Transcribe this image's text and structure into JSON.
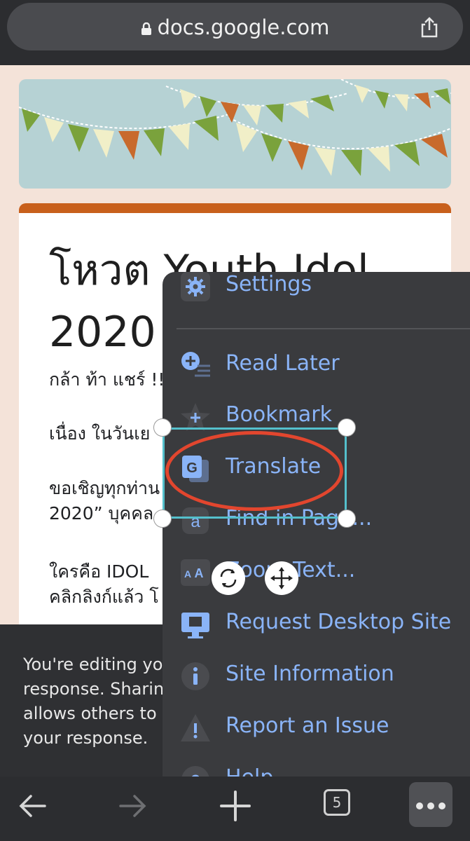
{
  "browser": {
    "url": "docs.google.com",
    "tab_count": "5"
  },
  "form": {
    "title": "โหวต Youth Idol 2020",
    "paragraphs": [
      "กล้า ท้า แชร์ !!",
      "เนื่อง ในวันเย",
      "ขอเชิญทุกท่าน",
      "2020” บุคคล",
      "ใครคือ IDOL",
      "คลิกลิงก์แล้ว โ"
    ]
  },
  "notice": {
    "text": "You're editing yo\nresponse. Sharin\nallows others to\nyour response."
  },
  "menu": {
    "items": [
      {
        "label": "Settings",
        "icon": "gear-icon"
      },
      {
        "label": "Read Later",
        "icon": "read-later-icon"
      },
      {
        "label": "Bookmark",
        "icon": "bookmark-star-icon"
      },
      {
        "label": "Translate",
        "icon": "translate-icon"
      },
      {
        "label": "Find in Page...",
        "icon": "find-icon"
      },
      {
        "label": "Zoom Text...",
        "icon": "text-size-icon"
      },
      {
        "label": "Request Desktop Site",
        "icon": "desktop-icon"
      },
      {
        "label": "Site Information",
        "icon": "info-icon"
      },
      {
        "label": "Report an Issue",
        "icon": "warning-icon"
      },
      {
        "label": "Help",
        "icon": "help-icon"
      }
    ]
  },
  "colors": {
    "menu_label": "#8ab4f8",
    "annotation_ellipse": "#e2462e",
    "selection_box": "#54c0cc"
  }
}
